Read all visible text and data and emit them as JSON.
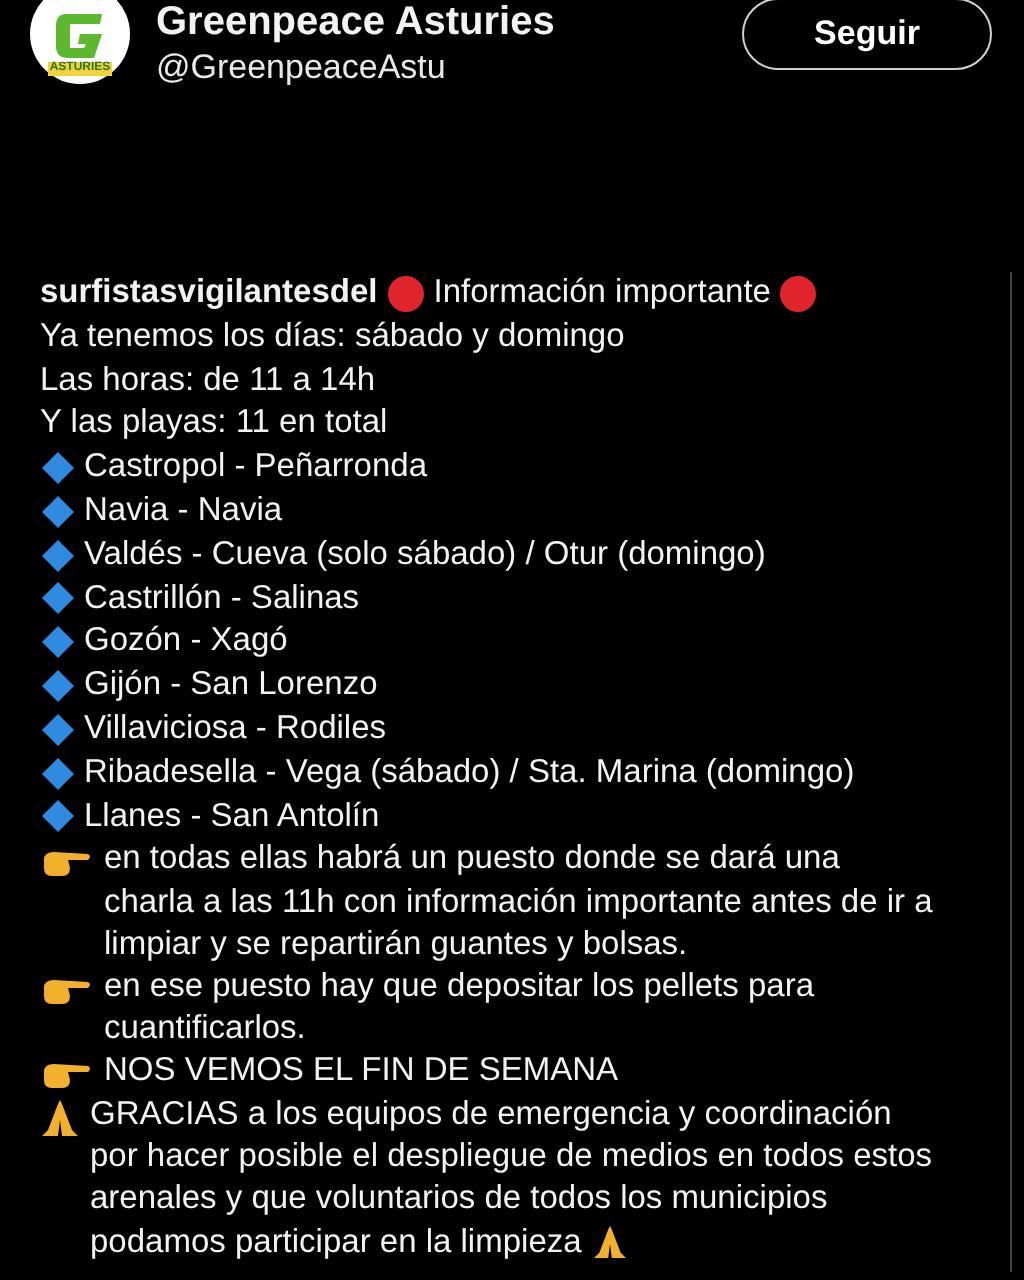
{
  "account": {
    "logo_text": "ASTURIES",
    "name": "Greenpeace Asturies",
    "handle": "@GreenpeaceAstu",
    "follow_button": "Seguir"
  },
  "post": {
    "lines": [
      {
        "kind": "heading",
        "user": "surfistasvigilantesdel",
        "text": "Información importante"
      },
      {
        "kind": "text",
        "text": "Ya tenemos los días: sábado y domingo"
      },
      {
        "kind": "text",
        "text": "Las horas: de 11 a 14h"
      },
      {
        "kind": "text",
        "text": "Y las playas: 11 en total"
      },
      {
        "kind": "bullet",
        "text": "Castropol - Peñarronda"
      },
      {
        "kind": "bullet",
        "text": "Navia - Navia"
      },
      {
        "kind": "bullet",
        "text": "Valdés - Cueva (solo sábado) / Otur (domingo)"
      },
      {
        "kind": "bullet",
        "text": "Castrillón - Salinas"
      },
      {
        "kind": "bullet",
        "text": "Gozón - Xagó"
      },
      {
        "kind": "bullet",
        "text": "Gijón - San Lorenzo"
      },
      {
        "kind": "bullet",
        "text": "Villaviciosa - Rodiles"
      },
      {
        "kind": "bullet",
        "text": "Ribadesella - Vega (sábado) / Sta. Marina (domingo)"
      },
      {
        "kind": "bullet",
        "text": "Llanes - San Antolín"
      },
      {
        "kind": "point",
        "text": "en todas ellas habrá un puesto donde se dará una\ncharla a las 11h con información importante antes de ir a\nlimpiar y se repartirán guantes y bolsas."
      },
      {
        "kind": "point",
        "text": "en ese puesto hay que depositar los pellets para\ncuantificarlos."
      },
      {
        "kind": "point",
        "text": "NOS VEMOS EL FIN DE SEMANA"
      },
      {
        "kind": "thanks",
        "text": "GRACIAS a los equipos de emergencia y coordinación\npor hacer posible el despliegue de medios en todos estos\narenales y que voluntarios de todos los municipios\npodamos participar en la limpieza"
      }
    ]
  }
}
